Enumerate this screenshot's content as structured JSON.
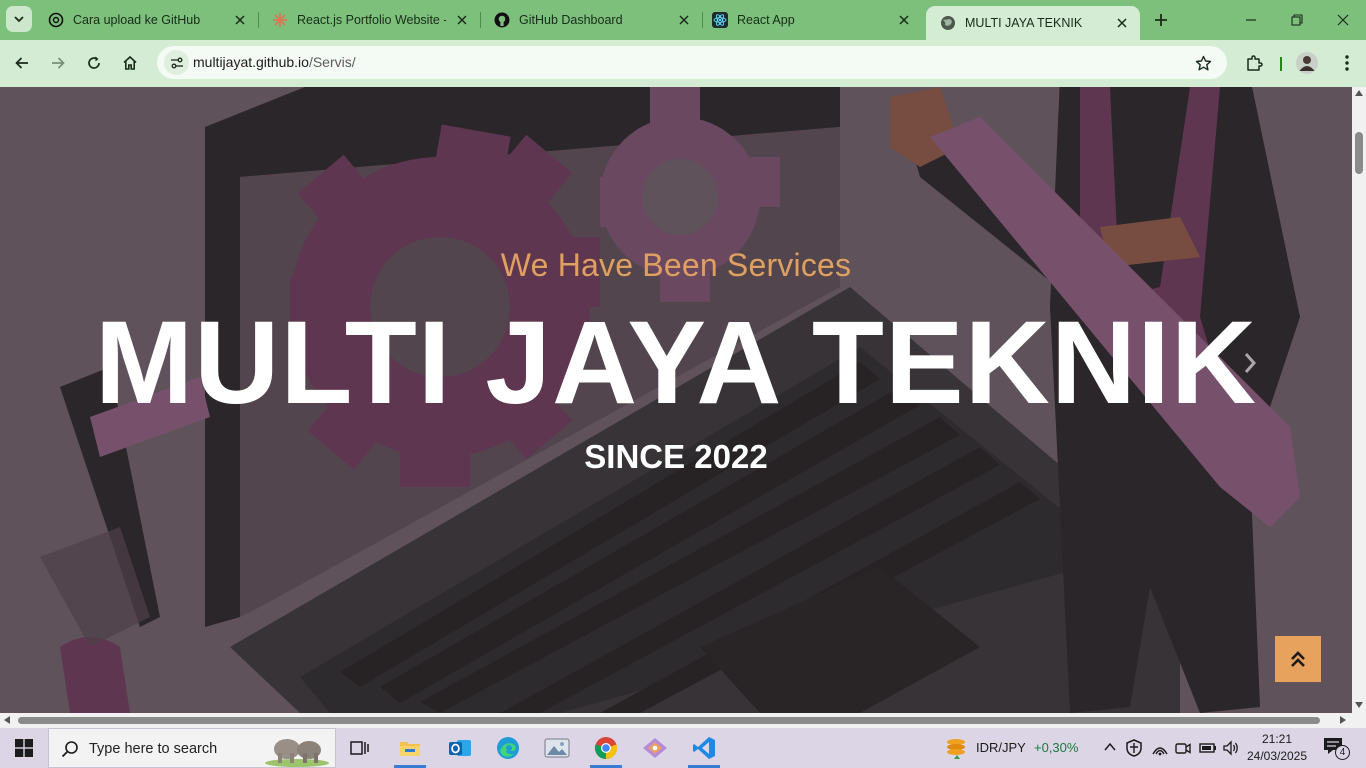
{
  "browser": {
    "tabs": [
      {
        "title": "Cara upload ke GitHub",
        "icon": "openai-icon",
        "active": false
      },
      {
        "title": "React.js Portfolio Website - Code",
        "icon": "claude-icon",
        "active": false
      },
      {
        "title": "GitHub Dashboard",
        "icon": "github-icon",
        "active": false
      },
      {
        "title": "React App",
        "icon": "react-icon",
        "active": false
      },
      {
        "title": "MULTI JAYA TEKNIK",
        "icon": "globe-icon",
        "active": true
      }
    ],
    "url_host": "multijayat.github.io",
    "url_path": "/Servis/"
  },
  "hero": {
    "subtitle": "We Have Been Services",
    "title": "MULTI JAYA TEKNIK",
    "since": "SINCE 2022"
  },
  "colors": {
    "accent": "#e7a25e",
    "subtitle": "#e0a060",
    "frame": "#7cc07c",
    "toolbar": "#d4ebd4",
    "gear": "#6e3d5c"
  },
  "taskbar": {
    "search_placeholder": "Type here to search",
    "ticker_symbol": "IDR/JPY",
    "ticker_change": "+0,30%",
    "time": "21:21",
    "date": "24/03/2025",
    "notification_count": "4"
  }
}
